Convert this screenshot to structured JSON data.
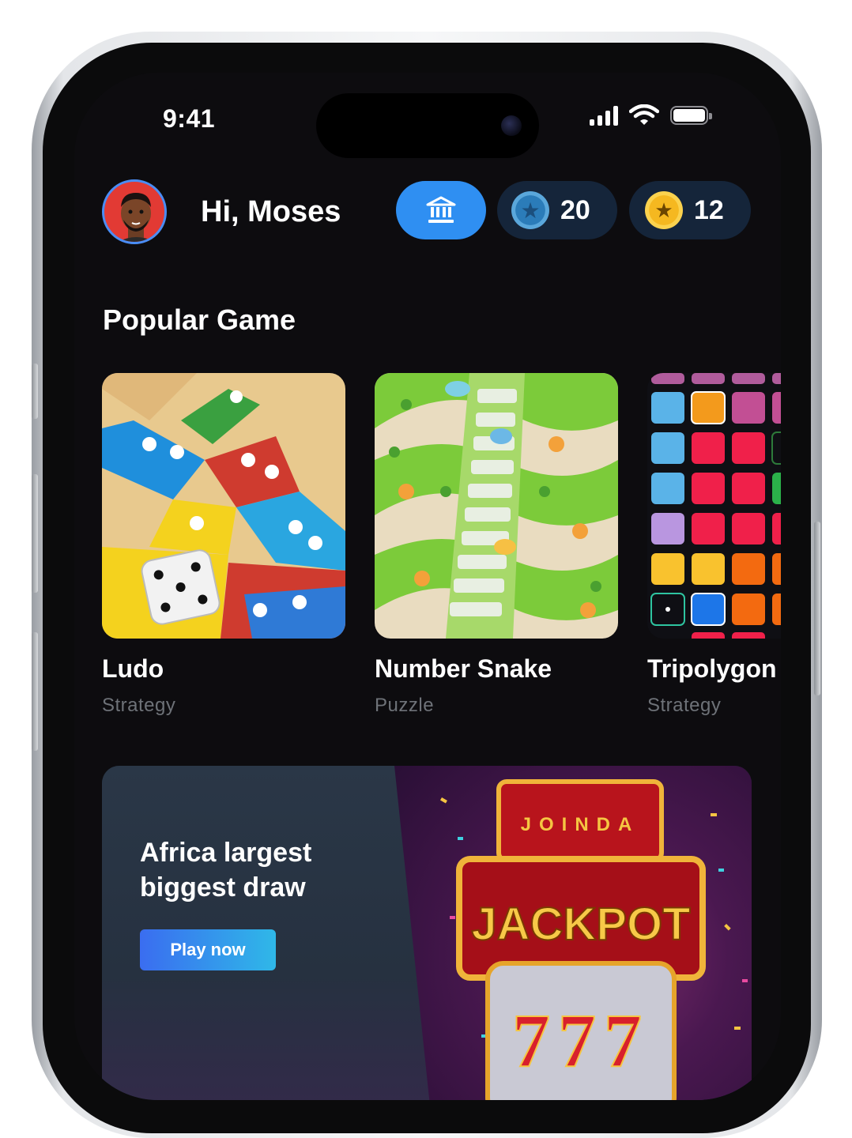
{
  "status_bar": {
    "time": "9:41"
  },
  "header": {
    "greeting": "Hi, Moses",
    "gems_count": "20",
    "coins_count": "12"
  },
  "popular": {
    "title": "Popular Game",
    "games": [
      {
        "name": "Ludo",
        "category": "Strategy"
      },
      {
        "name": "Number Snake",
        "category": "Puzzle"
      },
      {
        "name": "Tripolygon",
        "category": "Strategy"
      }
    ]
  },
  "banner": {
    "title": "Africa largest biggest draw",
    "button_label": "Play now",
    "sign_top": "JOINDA",
    "sign_main": "JACKPOT",
    "reels": "777"
  },
  "colors": {
    "background": "#0d0c0f",
    "accent_blue": "#2f8ff2",
    "pill_dark": "#15253a",
    "muted_text": "#6e7278"
  }
}
